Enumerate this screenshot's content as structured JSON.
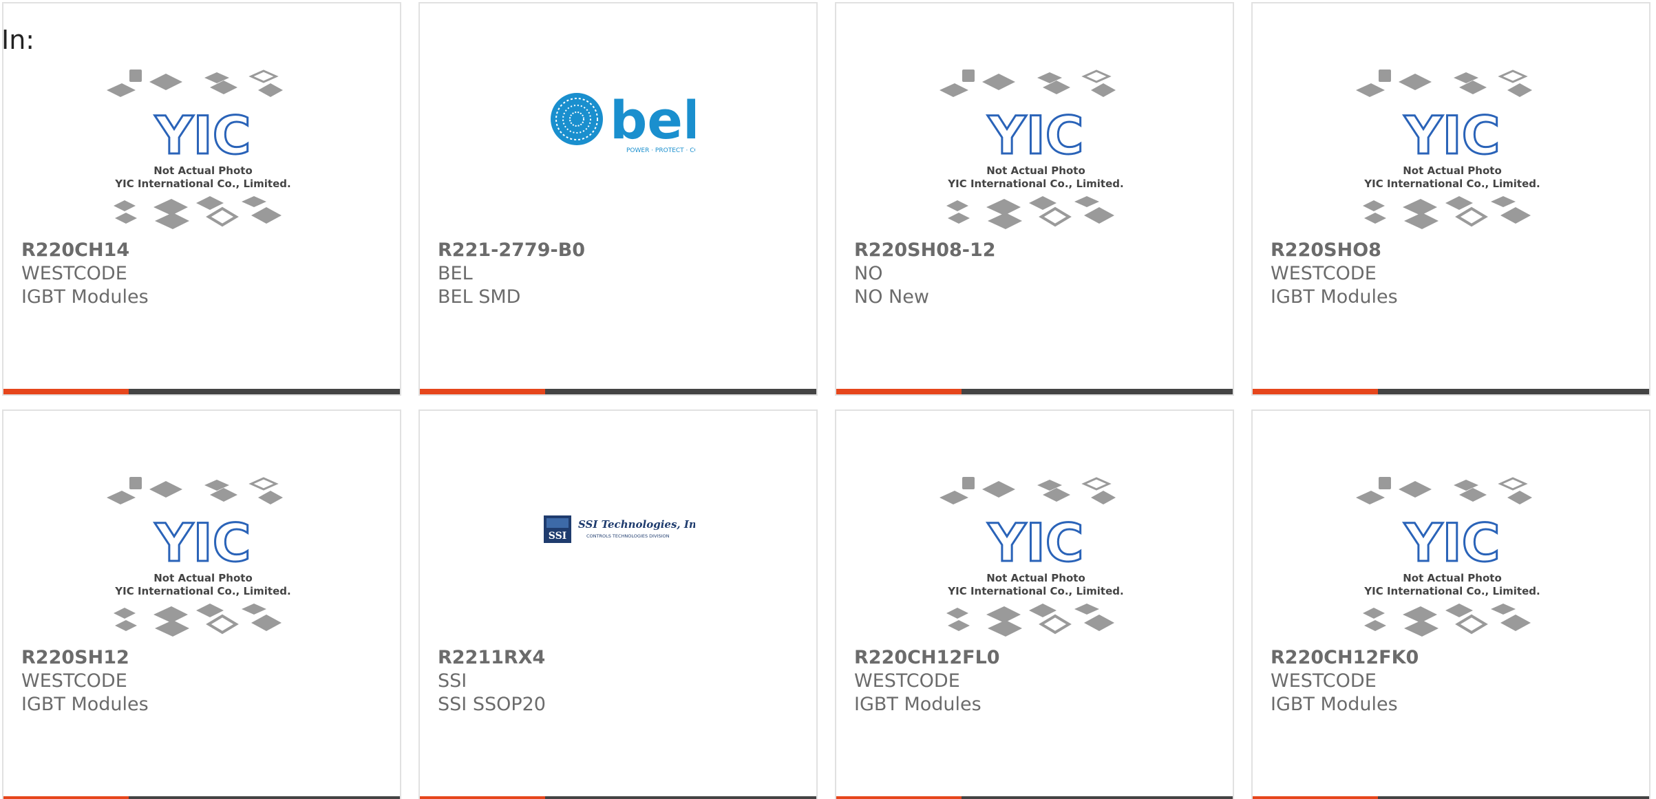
{
  "header": {
    "label": "In:"
  },
  "placeholder": {
    "line1": "Not Actual Photo",
    "line2": "YIC International Co., Limited.",
    "logo": "YIC"
  },
  "brands": {
    "bel_logo": "bel",
    "bel_tagline": "POWER · PROTECT · CONNECT",
    "ssi_name": "SSI Technologies, Inc.",
    "ssi_sub": "CONTROLS TECHNOLOGIES DIVISION",
    "ssi_mark": "SSI"
  },
  "colors": {
    "accent": "#e6461c",
    "bar": "#444444",
    "text": "#6b6b6b",
    "yic_blue": "#2a63b8",
    "bel_blue": "#1a8fce",
    "ssi_navy": "#1f3c6e"
  },
  "products": [
    {
      "part": "R220CH14",
      "maker": "WESTCODE",
      "category": "IGBT Modules",
      "image": "yic-placeholder"
    },
    {
      "part": "R221-2779-B0",
      "maker": "BEL",
      "category": "BEL SMD",
      "image": "bel-logo"
    },
    {
      "part": "R220SH08-12",
      "maker": "NO",
      "category": "NO New",
      "image": "yic-placeholder"
    },
    {
      "part": "R220SHO8",
      "maker": "WESTCODE",
      "category": "IGBT Modules",
      "image": "yic-placeholder"
    },
    {
      "part": "R220SH12",
      "maker": "WESTCODE",
      "category": "IGBT Modules",
      "image": "yic-placeholder"
    },
    {
      "part": "R2211RX4",
      "maker": "SSI",
      "category": "SSI SSOP20",
      "image": "ssi-logo"
    },
    {
      "part": "R220CH12FL0",
      "maker": "WESTCODE",
      "category": "IGBT Modules",
      "image": "yic-placeholder"
    },
    {
      "part": "R220CH12FK0",
      "maker": "WESTCODE",
      "category": "IGBT Modules",
      "image": "yic-placeholder"
    }
  ]
}
